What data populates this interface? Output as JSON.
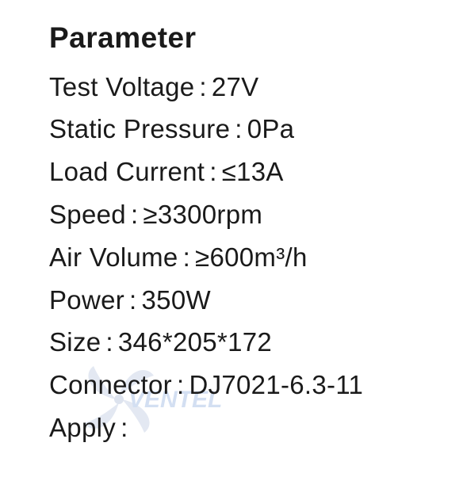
{
  "title": "Parameter",
  "params": [
    {
      "label": "Test Voltage",
      "sep": ":",
      "value": "27V"
    },
    {
      "label": "Static Pressure",
      "sep": ":",
      "value": "0Pa"
    },
    {
      "label": "Load Current",
      "sep": ":",
      "value": "≤13A"
    },
    {
      "label": "Speed",
      "sep": ":",
      "value": "≥3300rpm"
    },
    {
      "label": "Air Volume",
      "sep": ":",
      "value": "≥600m³/h"
    },
    {
      "label": "Power",
      "sep": ":",
      "value": "350W"
    },
    {
      "label": "Size",
      "sep": ":",
      "value": "346*205*172"
    },
    {
      "label": "Connector",
      "sep": ":",
      "value": "DJ7021-6.3-11"
    },
    {
      "label": "Apply",
      "sep": ":",
      "value": ""
    }
  ],
  "watermark": {
    "text": "VENTEL",
    "color": "#5b8fd6",
    "icon": "fan-logo-icon"
  }
}
